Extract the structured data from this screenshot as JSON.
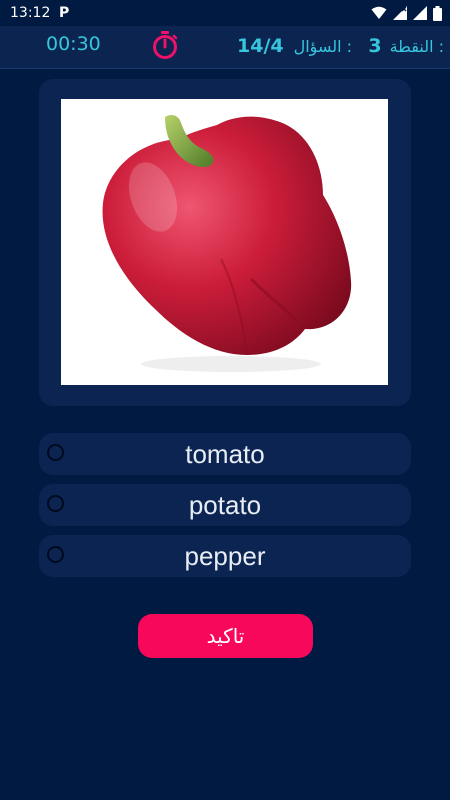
{
  "status": {
    "time": "13:12",
    "notification": "P",
    "icons": [
      "wifi-icon",
      "signal-icon",
      "signal-icon",
      "battery-icon"
    ]
  },
  "header": {
    "timer": "00:30",
    "question_label": "السؤال :",
    "question_value": "14/4",
    "score_label": "النقطة :",
    "score_value": "3",
    "accent_color": "#37c6dd",
    "stopwatch_color": "#f0116b"
  },
  "quiz": {
    "image_subject": "red bell pepper",
    "options": [
      "tomato",
      "potato",
      "pepper"
    ],
    "confirm_label": "تاكيد"
  },
  "colors": {
    "background": "#001a41",
    "card": "#0c2452",
    "button": "#f8085a"
  }
}
